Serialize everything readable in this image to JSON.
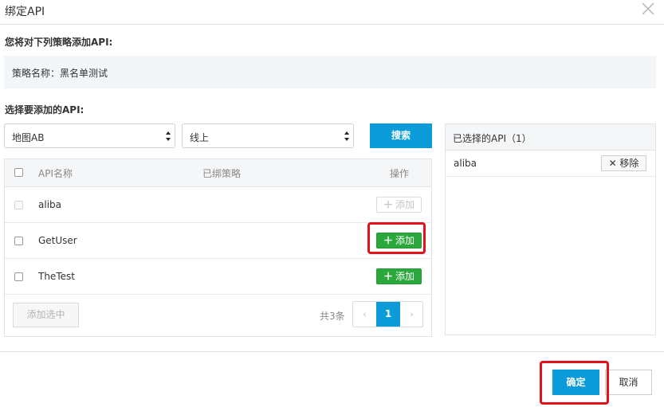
{
  "dialog": {
    "title": "绑定API",
    "close_icon": "close-icon"
  },
  "intro_label": "您将对下列策略添加API:",
  "policy": {
    "label": "策略名称：黑名单测试"
  },
  "choose_label": "选择要添加的API:",
  "filters": {
    "group_select_value": "地图AB",
    "env_select_value": "线上",
    "search_label": "搜索"
  },
  "table": {
    "headers": {
      "name": "API名称",
      "bound": "已绑策略",
      "action": "操作"
    },
    "rows": [
      {
        "name": "aliba",
        "action_label": "添加",
        "disabled": true
      },
      {
        "name": "GetUser",
        "action_label": "添加",
        "disabled": false
      },
      {
        "name": "TheTest",
        "action_label": "添加",
        "disabled": false
      }
    ],
    "add_selected_label": "添加选中",
    "total_label": "共3条",
    "pagination": {
      "prev": "‹",
      "current_page": "1",
      "next": "›"
    }
  },
  "selected_panel": {
    "title": "已选择的API（1）",
    "items": [
      {
        "name": "aliba",
        "remove_label": "✕ 移除"
      }
    ]
  },
  "footer": {
    "confirm_label": "确定",
    "cancel_label": "取消"
  },
  "colors": {
    "primary": "#0a9bd8",
    "success": "#2aa83b",
    "highlight": "#e1121c",
    "panel_bg": "#f2f6f9"
  }
}
